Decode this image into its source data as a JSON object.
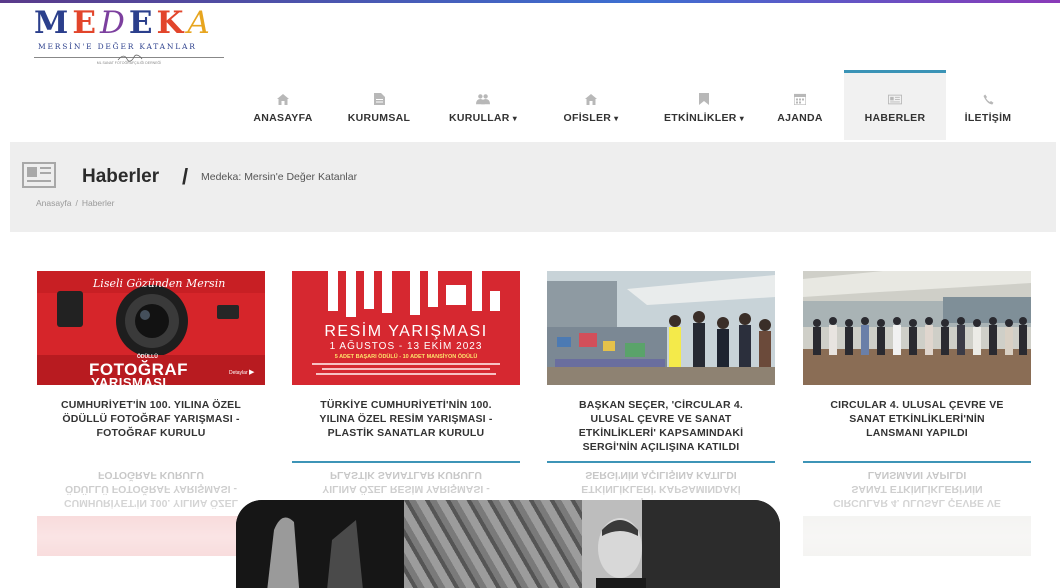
{
  "logo": {
    "letters": [
      "M",
      "E",
      "D",
      "E",
      "K",
      "A"
    ],
    "subtitle": "MERSİN'E DEĞER KATANLAR",
    "tiny": "ML SANAT FOTOĞRAFÇILIĞI DERNEĞİ"
  },
  "nav": {
    "items": [
      {
        "label": "ANASAYFA",
        "icon": "home-icon"
      },
      {
        "label": "KURUMSAL",
        "icon": "document-icon"
      },
      {
        "label": "KURULLAR",
        "icon": "users-icon",
        "dropdown": true
      },
      {
        "label": "OFİSLER",
        "icon": "home-icon",
        "dropdown": true
      },
      {
        "label": "ETKİNLİKLER",
        "icon": "bookmark-icon",
        "dropdown": true
      },
      {
        "label": "AJANDA",
        "icon": "calendar-icon"
      },
      {
        "label": "HABERLER",
        "icon": "newspaper-icon",
        "active": true
      },
      {
        "label": "İLETİŞİM",
        "icon": "phone-icon"
      }
    ],
    "caret": "▾"
  },
  "page_header": {
    "title": "Haberler",
    "slash": "/",
    "description": "Medeka: Mersin'e Değer Katanlar",
    "breadcrumb": [
      "Anasayfa",
      "Haberler"
    ],
    "separator": "/"
  },
  "cards": [
    {
      "title": "CUMHURİYET'İN 100. YILINA ÖZEL ÖDÜLLÜ FOTOĞRAF YARIŞMASI - FOTOĞRAF KURULU",
      "img_script": "Liseli Gözünden Mersin",
      "img_badge": "ÖDÜLLÜ",
      "img_title": "FOTOĞRAF",
      "img_title2": "YARIŞMASI",
      "img_button": "Detaylar"
    },
    {
      "title": "TÜRKİYE CUMHURİYETİ'NİN 100. YILINA ÖZEL RESİM YARIŞMASI - PLASTİK SANATLAR KURULU",
      "img_title": "RESİM YARIŞMASI",
      "img_dates": "1 AĞUSTOS - 13 EKİM 2023",
      "img_prizes": "5 ADET BAŞARI ÖDÜLÜ - 10 ADET MANSİYON ÖDÜLÜ"
    },
    {
      "title": "BAŞKAN SEÇER, 'CİRCULAR 4. ULUSAL ÇEVRE VE SANAT ETKİNLİKLERİ' KAPSAMINDAKİ SERGİ'NİN AÇILIŞINA KATILDI"
    },
    {
      "title": "CIRCULAR 4. ULUSAL ÇEVRE VE SANAT ETKİNLİKLERİ'NİN LANSMANI YAPILDI"
    }
  ],
  "colors": {
    "accent": "#3a93b6",
    "nav_text": "#333333",
    "band": "#eeeeee",
    "red": "#d6252a"
  }
}
